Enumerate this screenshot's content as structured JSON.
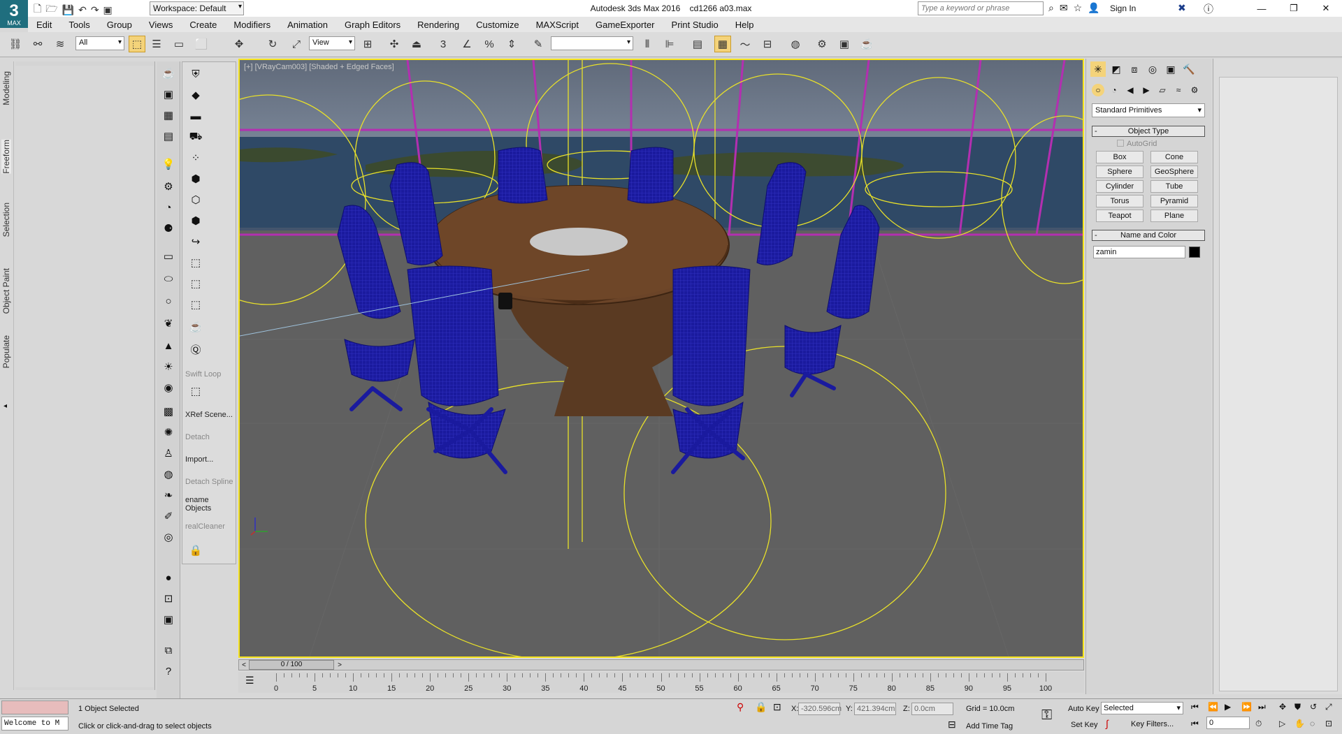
{
  "app": {
    "logo_text": "MAX",
    "title": "Autodesk 3ds Max 2016",
    "file": "cd1266 a03.max",
    "workspace": "Workspace: Default",
    "search_placeholder": "Type a keyword or phrase",
    "sign_in": "Sign In"
  },
  "menu": [
    "Edit",
    "Tools",
    "Group",
    "Views",
    "Create",
    "Modifiers",
    "Animation",
    "Graph Editors",
    "Rendering",
    "Customize",
    "MAXScript",
    "GameExporter",
    "Print Studio",
    "Help"
  ],
  "toolbar": {
    "filter_value": "All",
    "ref_coord_value": "View",
    "named_selection_value": ""
  },
  "side_tabs": [
    "Modeling",
    "Freeform",
    "Selection",
    "Object Paint",
    "Populate"
  ],
  "tool_column2": [
    {
      "label": "Swift Loop",
      "enabled": false
    },
    {
      "label": "XRef Scene...",
      "enabled": true
    },
    {
      "label": "Detach",
      "enabled": false
    },
    {
      "label": "Import...",
      "enabled": true
    },
    {
      "label": "Detach Spline",
      "enabled": false
    },
    {
      "label": "ename Objects",
      "enabled": true
    },
    {
      "label": "realCleaner",
      "enabled": false
    }
  ],
  "viewport": {
    "label": "[+] [VRayCam003] [Shaded + Edged Faces]"
  },
  "timeline": {
    "frame_label": "0 / 100",
    "ticks": [
      "0",
      "5",
      "10",
      "15",
      "20",
      "25",
      "30",
      "35",
      "40",
      "45",
      "50",
      "55",
      "60",
      "65",
      "70",
      "75",
      "80",
      "85",
      "90",
      "95",
      "100"
    ]
  },
  "command_panel": {
    "category": "Standard Primitives",
    "object_type_title": "Object Type",
    "autogrid": "AutoGrid",
    "buttons": [
      "Box",
      "Cone",
      "Sphere",
      "GeoSphere",
      "Cylinder",
      "Tube",
      "Torus",
      "Pyramid",
      "Teapot",
      "Plane"
    ],
    "name_color_title": "Name and Color",
    "object_name": "zamin",
    "object_color": "#000000"
  },
  "status": {
    "welcome": "Welcome to M",
    "selected": "1 Object Selected",
    "prompt": "Click or click-and-drag to select objects",
    "x_label": "X:",
    "x_value": "-320.596cm",
    "y_label": "Y:",
    "y_value": "421.394cm",
    "z_label": "Z:",
    "z_value": "0.0cm",
    "grid": "Grid = 10.0cm",
    "add_time_tag": "Add Time Tag",
    "auto_key": "Auto Key",
    "set_key": "Set Key",
    "key_mode": "Selected",
    "key_filters": "Key Filters...",
    "frame_value": "0"
  },
  "colors": {
    "viewport_border": "#f6e41d",
    "chair_blue": "#1a1a9e",
    "wire_yellow": "#e8e02a",
    "table_brown": "#6b4428",
    "active_button": "#f4d37a"
  }
}
